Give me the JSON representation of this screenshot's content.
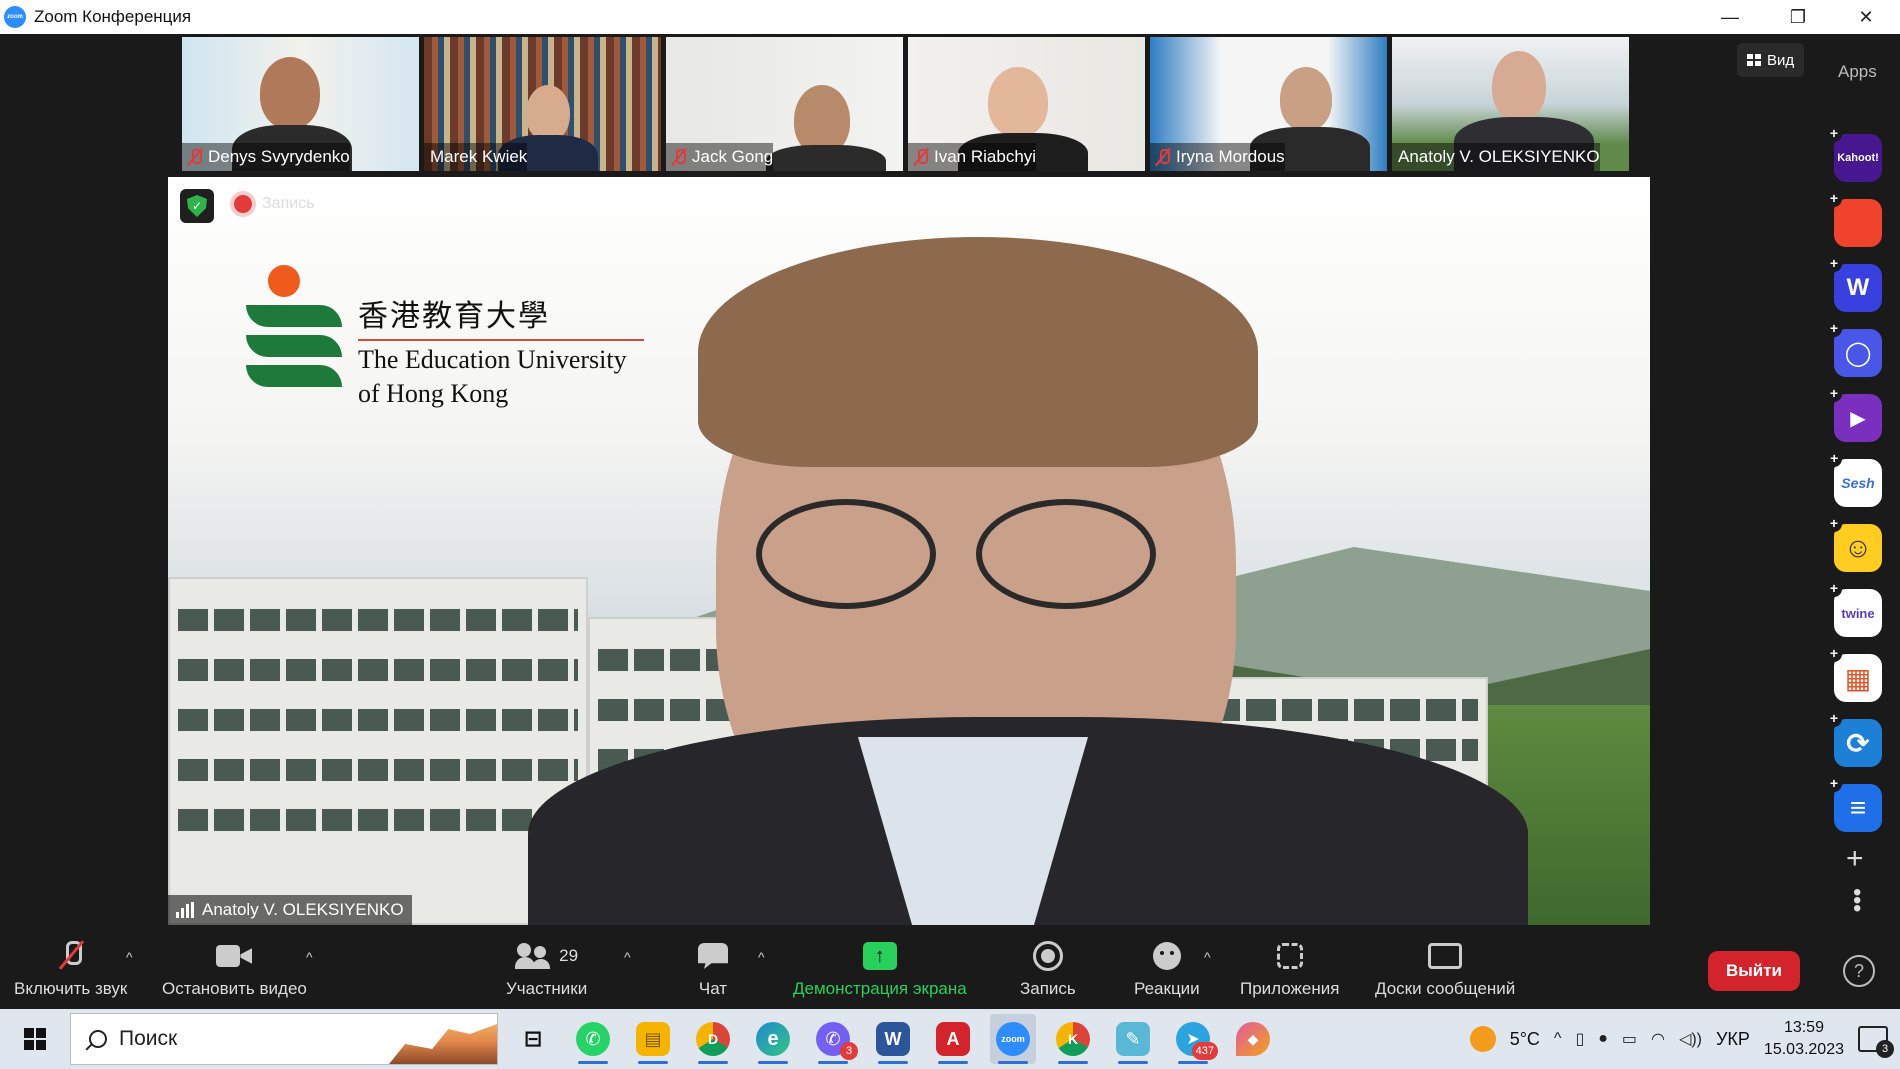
{
  "window": {
    "title": "Zoom Конференция",
    "app_icon_text": "zoom",
    "controls": [
      "—",
      "❐",
      "✕"
    ]
  },
  "top_right": {
    "view_label": "Вид",
    "apps_label": "Apps"
  },
  "participants_strip": [
    {
      "name": "Denys Svyrydenko",
      "muted": true
    },
    {
      "name": "Marek Kwiek",
      "muted": false
    },
    {
      "name": "Jack Gong",
      "muted": true
    },
    {
      "name": "Ivan Riabchyi",
      "muted": true
    },
    {
      "name": "Iryna Mordous",
      "muted": true
    },
    {
      "name": "Anatoly V. OLEKSIYENKO",
      "muted": false,
      "active": true
    }
  ],
  "main_video": {
    "speaker_name": "Anatoly V. OLEKSIYENKO",
    "recording_label": "Запись",
    "background_logo": {
      "cjk": "香港教育大學",
      "line1": "The Education University",
      "line2": "of Hong Kong"
    }
  },
  "app_rail": [
    {
      "name": "kahoot",
      "label": "Kahoot!",
      "color": "#46178f"
    },
    {
      "name": "orange-app",
      "label": "",
      "color": "#f0432b"
    },
    {
      "name": "wooclap",
      "label": "W",
      "color": "#3840e0"
    },
    {
      "name": "circle-app",
      "label": "◯",
      "color": "#4a56e8"
    },
    {
      "name": "vidgrid",
      "label": "▶",
      "color": "#7b2fbf"
    },
    {
      "name": "sesh",
      "label": "Sesh",
      "color": "#ffffff"
    },
    {
      "name": "emoji-app",
      "label": "☺",
      "color": "#ffcc1f"
    },
    {
      "name": "twine",
      "label": "twine",
      "color": "#ffffff"
    },
    {
      "name": "grid-app",
      "label": "▦",
      "color": "#ffffff"
    },
    {
      "name": "sync-app",
      "label": "⟳",
      "color": "#1e7fd6"
    },
    {
      "name": "stack-app",
      "label": "≡",
      "color": "#1e6fe8"
    }
  ],
  "toolbar": {
    "mic_label": "Включить звук",
    "video_label": "Остановить видео",
    "participants_label": "Участники",
    "participants_count": "29",
    "chat_label": "Чат",
    "share_label": "Демонстрация экрана",
    "record_label": "Запись",
    "reactions_label": "Реакции",
    "apps_label": "Приложения",
    "whiteboard_label": "Доски сообщений",
    "leave_label": "Выйти",
    "help_label": "?"
  },
  "taskbar": {
    "search_placeholder": "Поиск",
    "apps": [
      {
        "name": "task-view",
        "label": "⊟",
        "color": "#dfe6ee",
        "fg": "#111"
      },
      {
        "name": "whatsapp",
        "label": "✆",
        "color": "#25d366"
      },
      {
        "name": "file-explorer",
        "label": "▤",
        "color": "#f4b400"
      },
      {
        "name": "chrome-d",
        "label": "D",
        "color": "#db4437"
      },
      {
        "name": "edge",
        "label": "e",
        "color": "#1f8ad4"
      },
      {
        "name": "viber",
        "label": "✆",
        "color": "#7360f2",
        "badge": "3"
      },
      {
        "name": "word",
        "label": "W",
        "color": "#2b579a"
      },
      {
        "name": "acrobat",
        "label": "A",
        "color": "#d4242b"
      },
      {
        "name": "zoom",
        "label": "zoom",
        "color": "#2d8cff"
      },
      {
        "name": "chrome-k",
        "label": "K",
        "color": "#0f9d58"
      },
      {
        "name": "notepad",
        "label": "✎",
        "color": "#58b8d6"
      },
      {
        "name": "telegram",
        "label": "➤",
        "color": "#2aa3df",
        "badge": "437"
      },
      {
        "name": "paint",
        "label": "◆",
        "color": "#e05aa0"
      }
    ],
    "weather": "5°C",
    "lang": "УКР",
    "time": "13:59",
    "date": "15.03.2023",
    "notifications": "3"
  }
}
